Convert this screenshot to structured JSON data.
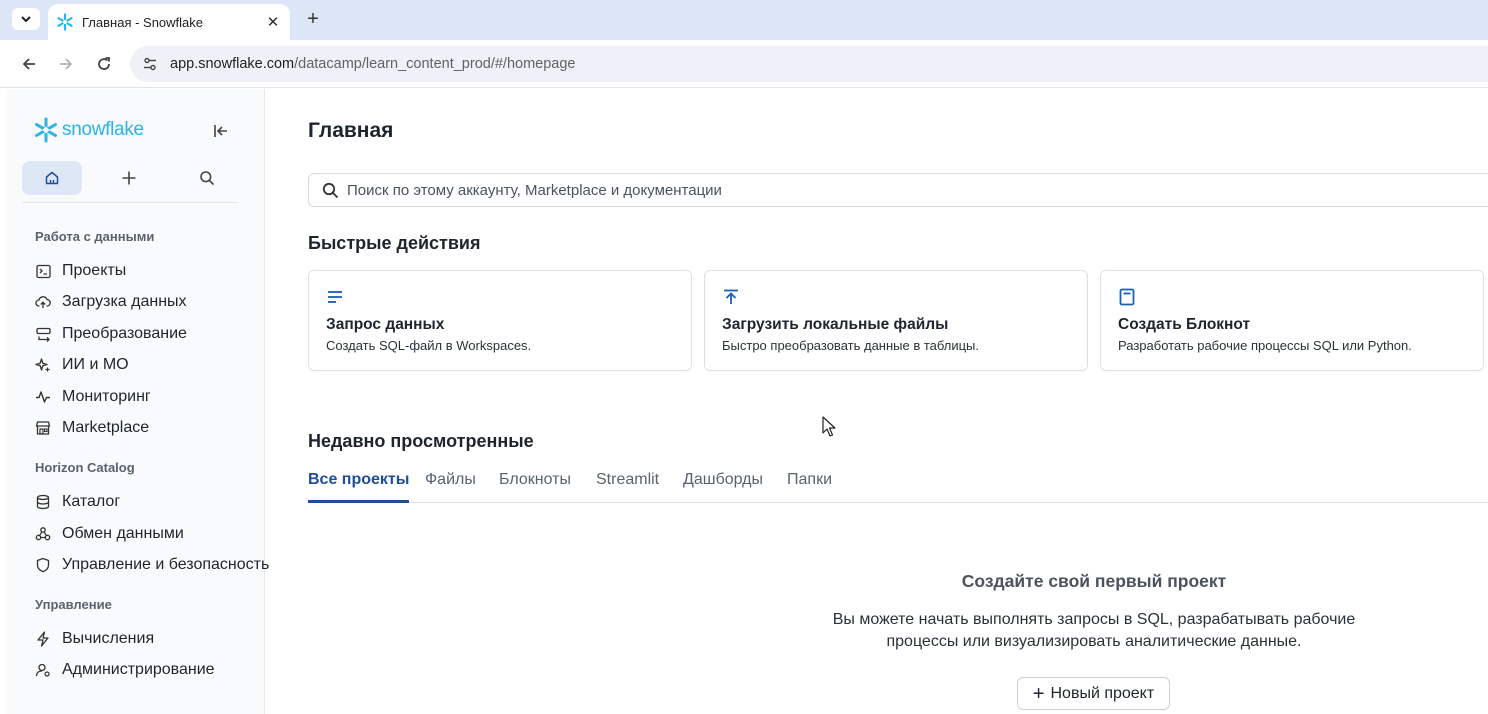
{
  "browser": {
    "tab_title": "Главная - Snowflake",
    "url_host": "app.snowflake.com",
    "url_path": "/datacamp/learn_content_prod/#/homepage"
  },
  "sidebar": {
    "logo_text": "snowflake",
    "sections": [
      {
        "title": "Работа с данными",
        "items": [
          {
            "label": "Проекты",
            "icon": "projects-icon"
          },
          {
            "label": "Загрузка данных",
            "icon": "cloud-upload-icon"
          },
          {
            "label": "Преобразование",
            "icon": "transform-icon"
          },
          {
            "label": "ИИ и МО",
            "icon": "sparkle-icon"
          },
          {
            "label": "Мониторинг",
            "icon": "activity-icon"
          },
          {
            "label": "Marketplace",
            "icon": "store-icon"
          }
        ]
      },
      {
        "title": "Horizon Catalog",
        "items": [
          {
            "label": "Каталог",
            "icon": "database-icon"
          },
          {
            "label": "Обмен данными",
            "icon": "share-icon"
          },
          {
            "label": "Управление и безопасность",
            "icon": "shield-icon"
          }
        ]
      },
      {
        "title": "Управление",
        "items": [
          {
            "label": "Вычисления",
            "icon": "bolt-icon"
          },
          {
            "label": "Администрирование",
            "icon": "admin-icon"
          }
        ]
      }
    ]
  },
  "main": {
    "title": "Главная",
    "search_placeholder": "Поиск по этому аккаунту, Marketplace и документации",
    "quick_actions_title": "Быстрые действия",
    "cards": [
      {
        "title": "Запрос данных",
        "desc": "Создать SQL-файл в Workspaces.",
        "icon": "query-icon"
      },
      {
        "title": "Загрузить локальные файлы",
        "desc": "Быстро преобразовать данные в таблицы.",
        "icon": "upload-icon"
      },
      {
        "title": "Создать Блокнот",
        "desc": "Разработать рабочие процессы SQL или Python.",
        "icon": "notebook-icon"
      }
    ],
    "recent_title": "Недавно просмотренные",
    "tabs": [
      "Все проекты",
      "Файлы",
      "Блокноты",
      "Streamlit",
      "Дашборды",
      "Папки"
    ],
    "active_tab": "Все проекты",
    "empty_title": "Создайте свой первый проект",
    "empty_desc_line1": "Вы можете начать выполнять запросы в SQL, разрабатывать рабочие",
    "empty_desc_line2": "процессы или визуализировать аналитические данные.",
    "new_project_label": "Новый проект"
  },
  "colors": {
    "accent": "#1c4e9d",
    "brand": "#29b5e8",
    "card_icon": "#1a5fb4"
  }
}
